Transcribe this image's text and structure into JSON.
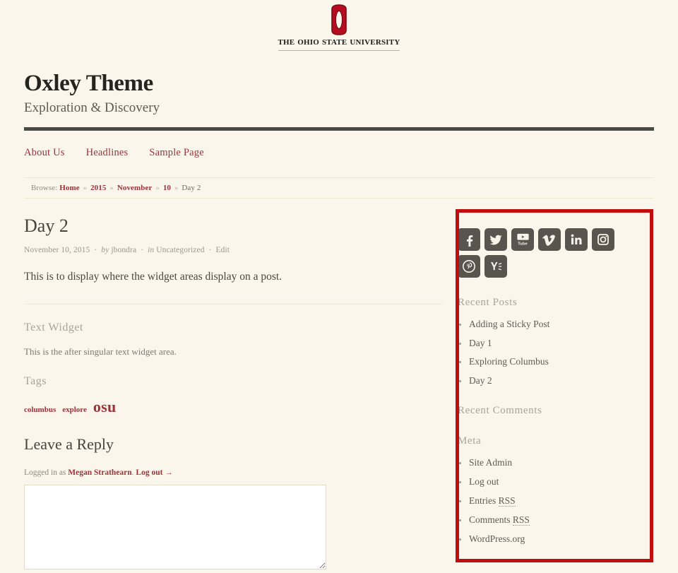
{
  "masthead": {
    "logo_icon": "osu-block-o-icon",
    "wordmark": "The Ohio State University",
    "logo_color": "#b50d1f"
  },
  "site": {
    "title": "Oxley Theme",
    "tagline": "Exploration & Discovery"
  },
  "nav": {
    "items": [
      {
        "label": "About Us"
      },
      {
        "label": "Headlines"
      },
      {
        "label": "Sample Page"
      }
    ]
  },
  "breadcrumb": {
    "label": "Browse:",
    "items": [
      {
        "label": "Home",
        "current": false
      },
      {
        "label": "2015",
        "current": false
      },
      {
        "label": "November",
        "current": false
      },
      {
        "label": "10",
        "current": false
      },
      {
        "label": "Day 2",
        "current": true
      }
    ],
    "separator": "»"
  },
  "post": {
    "title": "Day 2",
    "date": "November 10, 2015",
    "by_label": "by",
    "author": "jbondra",
    "in_label": "in",
    "category": "Uncategorized",
    "edit_label": "Edit",
    "separator": "·",
    "body": "This is to display where the widget areas display on a post."
  },
  "after_post_widgets": {
    "text_widget": {
      "title": "Text Widget",
      "body": "This is the after singular text widget area."
    },
    "tags_widget": {
      "title": "Tags",
      "tags": [
        {
          "label": "columbus",
          "size": "small"
        },
        {
          "label": "explore",
          "size": "small"
        },
        {
          "label": "osu",
          "size": "large"
        }
      ]
    }
  },
  "comments": {
    "title": "Leave a Reply",
    "logged_in_prefix": "Logged in as",
    "user": "Megan Strathearn",
    "logout_label": "Log out →",
    "textarea_value": "",
    "textarea_placeholder": ""
  },
  "sidebar": {
    "social": {
      "icons": [
        {
          "name": "facebook-icon",
          "title": "Facebook"
        },
        {
          "name": "twitter-icon",
          "title": "Twitter"
        },
        {
          "name": "youtube-icon",
          "title": "YouTube"
        },
        {
          "name": "vimeo-icon",
          "title": "Vimeo"
        },
        {
          "name": "linkedin-icon",
          "title": "LinkedIn"
        },
        {
          "name": "instagram-icon",
          "title": "Instagram"
        },
        {
          "name": "pinterest-icon",
          "title": "Pinterest"
        },
        {
          "name": "yammer-icon",
          "title": "Yammer"
        }
      ],
      "background_color": "#58554f"
    },
    "recent_posts": {
      "title": "Recent Posts",
      "items": [
        {
          "label": "Adding a Sticky Post"
        },
        {
          "label": "Day 1"
        },
        {
          "label": "Exploring Columbus"
        },
        {
          "label": "Day 2"
        }
      ]
    },
    "recent_comments": {
      "title": "Recent Comments",
      "items": []
    },
    "meta": {
      "title": "Meta",
      "items": [
        {
          "label": "Site Admin",
          "abbr": ""
        },
        {
          "label": "Log out",
          "abbr": ""
        },
        {
          "label": "Entries ",
          "abbr": "RSS"
        },
        {
          "label": "Comments ",
          "abbr": "RSS"
        },
        {
          "label": "WordPress.org",
          "abbr": ""
        }
      ]
    }
  },
  "annotation": {
    "name": "sidebar-highlight-box",
    "color": "#c00d0d"
  }
}
